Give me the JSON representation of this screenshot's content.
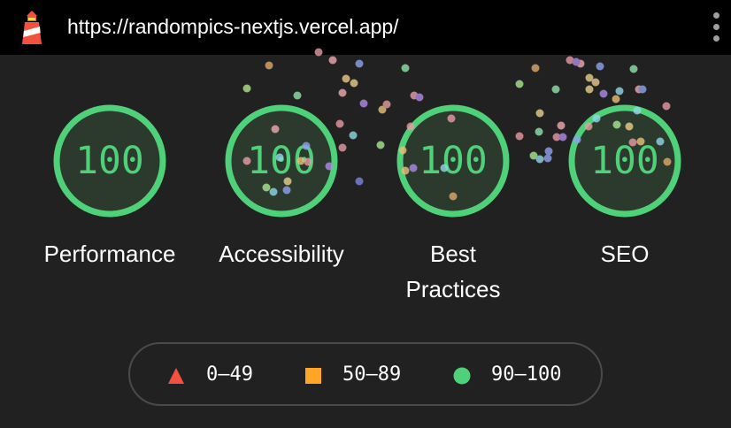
{
  "browser": {
    "url": "https://randompics-nextjs.vercel.app/",
    "logo_icon": "lighthouse-icon",
    "menu_icon": "more-vert-icon"
  },
  "scores": [
    {
      "category": "Performance",
      "value": "100"
    },
    {
      "category": "Accessibility",
      "value": "100"
    },
    {
      "category": "Best Practices",
      "value": "100"
    },
    {
      "category": "SEO",
      "value": "100"
    }
  ],
  "legend": [
    {
      "range": "0–49",
      "shape": "triangle-icon",
      "color": "#f2513f"
    },
    {
      "range": "50–89",
      "shape": "square-icon",
      "color": "#ffa629"
    },
    {
      "range": "90–100",
      "shape": "circle-icon",
      "color": "#4fd17a"
    }
  ],
  "colors": {
    "background": "#212121",
    "topbar": "#000000",
    "pass": "#4fd17a",
    "gauge_fill": "#2c3a2e"
  }
}
